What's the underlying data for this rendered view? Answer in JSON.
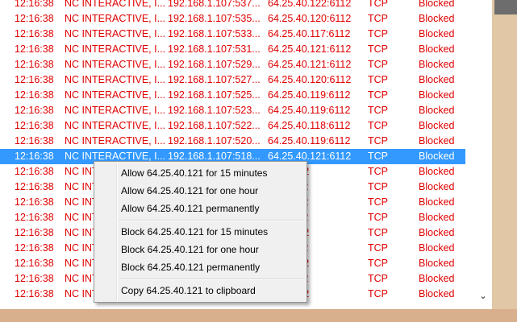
{
  "connections": [
    {
      "time": "12:16:38",
      "name": "NC INTERACTIVE, I...",
      "source": "192.168.1.107:537...",
      "destination": "64.25.40.122:6112",
      "protocol": "TCP",
      "status": "Blocked"
    },
    {
      "time": "12:16:38",
      "name": "NC INTERACTIVE, I...",
      "source": "192.168.1.107:535...",
      "destination": "64.25.40.120:6112",
      "protocol": "TCP",
      "status": "Blocked"
    },
    {
      "time": "12:16:38",
      "name": "NC INTERACTIVE, I...",
      "source": "192.168.1.107:533...",
      "destination": "64.25.40.117:6112",
      "protocol": "TCP",
      "status": "Blocked"
    },
    {
      "time": "12:16:38",
      "name": "NC INTERACTIVE, I...",
      "source": "192.168.1.107:531...",
      "destination": "64.25.40.121:6112",
      "protocol": "TCP",
      "status": "Blocked"
    },
    {
      "time": "12:16:38",
      "name": "NC INTERACTIVE, I...",
      "source": "192.168.1.107:529...",
      "destination": "64.25.40.121:6112",
      "protocol": "TCP",
      "status": "Blocked"
    },
    {
      "time": "12:16:38",
      "name": "NC INTERACTIVE, I...",
      "source": "192.168.1.107:527...",
      "destination": "64.25.40.120:6112",
      "protocol": "TCP",
      "status": "Blocked"
    },
    {
      "time": "12:16:38",
      "name": "NC INTERACTIVE, I...",
      "source": "192.168.1.107:525...",
      "destination": "64.25.40.119:6112",
      "protocol": "TCP",
      "status": "Blocked"
    },
    {
      "time": "12:16:38",
      "name": "NC INTERACTIVE, I...",
      "source": "192.168.1.107:523...",
      "destination": "64.25.40.119:6112",
      "protocol": "TCP",
      "status": "Blocked"
    },
    {
      "time": "12:16:38",
      "name": "NC INTERACTIVE, I...",
      "source": "192.168.1.107:522...",
      "destination": "64.25.40.118:6112",
      "protocol": "TCP",
      "status": "Blocked"
    },
    {
      "time": "12:16:38",
      "name": "NC INTERACTIVE, I...",
      "source": "192.168.1.107:520...",
      "destination": "64.25.40.119:6112",
      "protocol": "TCP",
      "status": "Blocked"
    },
    {
      "time": "12:16:38",
      "name": "NC INTERACTIVE, I...",
      "source": "192.168.1.107:518...",
      "destination": "64.25.40.121:6112",
      "protocol": "TCP",
      "status": "Blocked",
      "selected": true
    },
    {
      "time": "12:16:38",
      "name": "NC INT",
      "source": "",
      "destination": "121:6112",
      "protocol": "TCP",
      "status": "Blocked"
    },
    {
      "time": "12:16:38",
      "name": "NC INT",
      "source": "",
      "destination": "116:6112",
      "protocol": "TCP",
      "status": "Blocked"
    },
    {
      "time": "12:16:38",
      "name": "NC INT",
      "source": "",
      "destination": "119:6112",
      "protocol": "TCP",
      "status": "Blocked"
    },
    {
      "time": "12:16:38",
      "name": "NC INT",
      "source": "",
      "destination": "116:6112",
      "protocol": "TCP",
      "status": "Blocked"
    },
    {
      "time": "12:16:38",
      "name": "NC INT",
      "source": "",
      "destination": "120:6112",
      "protocol": "TCP",
      "status": "Blocked"
    },
    {
      "time": "12:16:38",
      "name": "NC INT",
      "source": "",
      "destination": "116:6112",
      "protocol": "TCP",
      "status": "Blocked"
    },
    {
      "time": "12:16:38",
      "name": "NC INT",
      "source": "",
      "destination": "120:6112",
      "protocol": "TCP",
      "status": "Blocked"
    },
    {
      "time": "12:16:38",
      "name": "NC INT",
      "source": "",
      "destination": "118:6112",
      "protocol": "TCP",
      "status": "Blocked"
    },
    {
      "time": "12:16:38",
      "name": "NC INT",
      "source": "",
      "destination": "120:6112",
      "protocol": "TCP",
      "status": "Blocked"
    }
  ],
  "context_menu": {
    "allow_15min": "Allow 64.25.40.121 for 15 minutes",
    "allow_hour": "Allow 64.25.40.121 for one hour",
    "allow_perm": "Allow 64.25.40.121 permanently",
    "block_15min": "Block 64.25.40.121 for 15 minutes",
    "block_hour": "Block 64.25.40.121 for one hour",
    "block_perm": "Block 64.25.40.121 permanently",
    "copy": "Copy 64.25.40.121 to clipboard"
  },
  "colors": {
    "blocked_text": "#e00000",
    "selection": "#3399ff"
  },
  "icons": {
    "scroll_down": "chevron-down-icon"
  },
  "glyphs": {
    "scroll_down": "⌄"
  }
}
